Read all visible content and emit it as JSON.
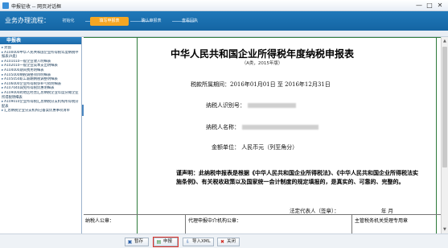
{
  "window": {
    "title": "申报征收 -- 网页对话框",
    "minimize": "—",
    "maximize": "□",
    "close": "✕"
  },
  "stepbar": {
    "flow_label": "业务办理流程：",
    "steps": [
      {
        "label": "初始化",
        "active": false
      },
      {
        "label": "填写申报表",
        "active": true
      },
      {
        "label": "确认申报表",
        "active": false
      },
      {
        "label": "查看回执",
        "active": false
      }
    ]
  },
  "sidebar": {
    "title": "申报表",
    "items": [
      "封面",
      "A100000中华人民共和国企业所得税年度纳税申报表(A类)",
      "A101010一般企业收入明细表",
      "A102010一般企业成本支出明细表",
      "A104000期间费用明细表",
      "A105000纳税调整项目明细表",
      "A105050职工薪酬纳税调整明细表",
      "A106000企业所得税弥补亏损明细表",
      "A107040减免所得税优惠明细表",
      "A109000跨地区经营汇总纳税企业年度分摊企业所得税明细表",
      "A109010企业所得税汇总纳税分支机构所得税分配表",
      "汇总纳税企业分支机构已备案优惠事项清单"
    ]
  },
  "document": {
    "title": "中华人民共和国企业所得税年度纳税申报表",
    "subtitle": "（A类，2015年版）",
    "period_label": "税款所属期间：",
    "period_from": "2016年01月01日",
    "period_to_word": "至",
    "period_to": "2016年12月31日",
    "taxpayer_id_label": "纳税人识别号：",
    "taxpayer_name_label": "纳税人名称：",
    "currency_label": "金额单位：",
    "currency_value": "人民币元（列至角分）",
    "declaration": "谨声明：此纳税申报表是根据《中华人民共和国企业所得税法》、《中华人民共和国企业所得税法实施条例》、有关税收政策以及国家统一会计制度的规定填报的，是真实的、可靠的、完整的。",
    "legal_rep_label": "法定代表人（签章）：",
    "date_suffix": "年  月",
    "taxpayer_seal_label": "纳税人公章：",
    "agent_seal_label": "代理申报中介机构公章：",
    "tax_office_label": "主管税务机关受理专用章"
  },
  "bottombar": {
    "buttons": [
      {
        "label": "暂存",
        "icon": "save-icon"
      },
      {
        "label": "申报",
        "icon": "submit-icon"
      },
      {
        "label": "导入XML",
        "icon": "import-icon"
      },
      {
        "label": "关闭",
        "icon": "close-icon"
      }
    ]
  }
}
